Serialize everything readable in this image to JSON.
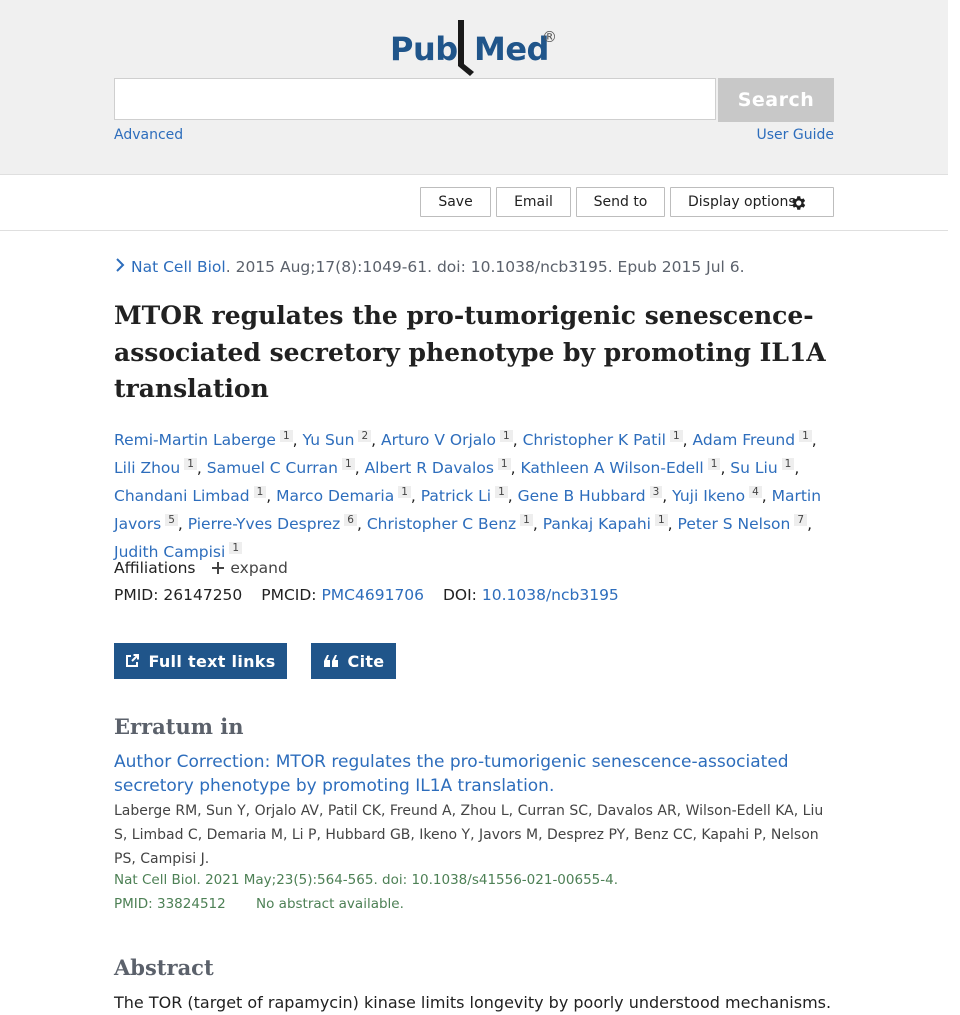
{
  "header": {
    "logo_pub": "Pub",
    "logo_med": "Med",
    "logo_reg": "®",
    "search_button": "Search",
    "search_placeholder": "",
    "advanced_link": "Advanced",
    "user_guide_link": "User Guide"
  },
  "actions": {
    "save": "Save",
    "email": "Email",
    "send_to": "Send to",
    "display_options": "Display options"
  },
  "citation": {
    "journal": "Nat Cell Biol",
    "details": ". 2015 Aug;17(8):1049-61. doi: 10.1038/ncb3195. Epub 2015 Jul 6."
  },
  "article": {
    "title": "MTOR regulates the pro-tumorigenic senescence-associated secretory phenotype by promoting IL1A translation",
    "authors": [
      {
        "name": "Remi-Martin Laberge",
        "aff": "1"
      },
      {
        "name": "Yu Sun",
        "aff": "2"
      },
      {
        "name": "Arturo V Orjalo",
        "aff": "1"
      },
      {
        "name": "Christopher K Patil",
        "aff": "1"
      },
      {
        "name": "Adam Freund",
        "aff": "1"
      },
      {
        "name": "Lili Zhou",
        "aff": "1"
      },
      {
        "name": "Samuel C Curran",
        "aff": "1"
      },
      {
        "name": "Albert R Davalos",
        "aff": "1"
      },
      {
        "name": "Kathleen A Wilson-Edell",
        "aff": "1"
      },
      {
        "name": "Su Liu",
        "aff": "1"
      },
      {
        "name": "Chandani Limbad",
        "aff": "1"
      },
      {
        "name": "Marco Demaria",
        "aff": "1"
      },
      {
        "name": "Patrick Li",
        "aff": "1"
      },
      {
        "name": "Gene B Hubbard",
        "aff": "3"
      },
      {
        "name": "Yuji Ikeno",
        "aff": "4"
      },
      {
        "name": "Martin Javors",
        "aff": "5"
      },
      {
        "name": "Pierre-Yves Desprez",
        "aff": "6"
      },
      {
        "name": "Christopher C Benz",
        "aff": "1"
      },
      {
        "name": "Pankaj Kapahi",
        "aff": "1"
      },
      {
        "name": "Peter S Nelson",
        "aff": "7"
      },
      {
        "name": "Judith Campisi",
        "aff": "1"
      }
    ],
    "affiliations_label": "Affiliations",
    "expand_label": "expand",
    "pmid_label": "PMID:",
    "pmid": "26147250",
    "pmcid_label": "PMCID:",
    "pmcid": "PMC4691706",
    "doi_label": "DOI:",
    "doi": "10.1038/ncb3195"
  },
  "buttons": {
    "full_text": "Full text links",
    "cite": "Cite"
  },
  "erratum": {
    "heading": "Erratum in",
    "title": "Author Correction: MTOR regulates the pro-tumorigenic senescence-associated secretory phenotype by promoting IL1A translation.",
    "authors": "Laberge RM, Sun Y, Orjalo AV, Patil CK, Freund A, Zhou L, Curran SC, Davalos AR, Wilson-Edell KA, Liu S, Limbad C, Demaria M, Li P, Hubbard GB, Ikeno Y, Javors M, Desprez PY, Benz CC, Kapahi P, Nelson PS, Campisi J.",
    "source": "Nat Cell Biol. 2021 May;23(5):564-565. doi: 10.1038/s41556-021-00655-4.",
    "pmid": "PMID: 33824512",
    "no_abstract": "No abstract available."
  },
  "abstract": {
    "heading": "Abstract",
    "text": "The TOR (target of rapamycin) kinase limits longevity by poorly understood mechanisms."
  },
  "colors": {
    "link": "#2d6dbc",
    "brand": "#20558a",
    "source_green": "#4d8055",
    "header_bg": "#f0f0f0"
  }
}
